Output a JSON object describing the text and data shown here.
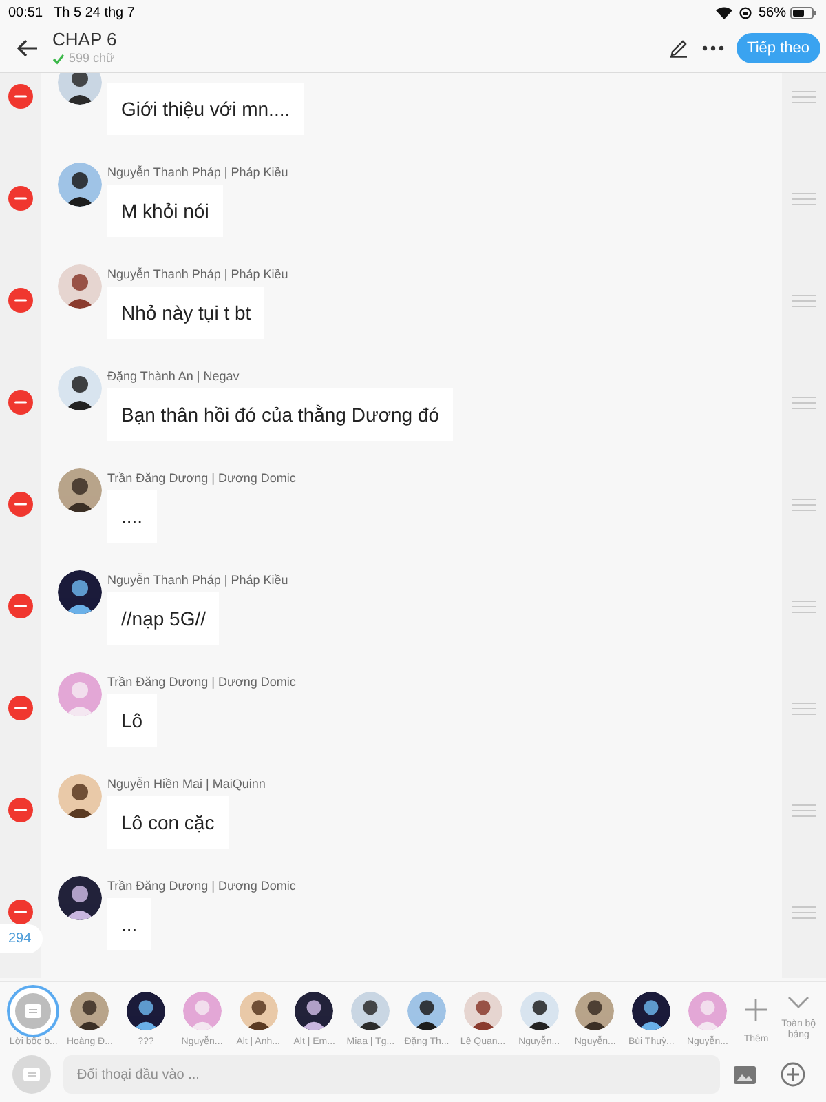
{
  "status_bar": {
    "time": "00:51",
    "date": "Th 5 24 thg 7",
    "battery": "56%"
  },
  "header": {
    "title": "CHAP 6",
    "word_count": "599 chữ",
    "next_button": "Tiếp theo"
  },
  "messages": [
    {
      "text": "Giới thiệu với mn...."
    },
    {
      "name": "Nguyễn Thanh Pháp | Pháp Kiều",
      "text": "M khỏi nói"
    },
    {
      "name": "Nguyễn Thanh Pháp | Pháp Kiều",
      "text": "Nhỏ này tụi t bt"
    },
    {
      "name": "Đặng Thành An | Negav",
      "text": "Bạn thân hồi đó của thằng Dương đó"
    },
    {
      "name": "Trần Đăng Dương | Dương Domic",
      "text": "...."
    },
    {
      "name": "Nguyễn Thanh Pháp | Pháp Kiều",
      "text": "//nạp 5G//"
    },
    {
      "name": "Trần Đăng Dương | Dương Domic",
      "text": "Lô"
    },
    {
      "name": "Nguyễn Hiền Mai | MaiQuinn",
      "text": "Lô con cặc"
    },
    {
      "name": "Trần Đăng Dương | Dương Domic",
      "text": "..."
    }
  ],
  "count_badge": "294",
  "cast": [
    {
      "kind": "narrator",
      "label": "Lời bốc b...",
      "selected": true
    },
    {
      "kind": "character",
      "label": "Hoàng Đ...",
      "selected": false
    },
    {
      "kind": "character",
      "label": "???",
      "selected": false
    },
    {
      "kind": "character",
      "label": "Nguyễn...",
      "selected": false
    },
    {
      "kind": "character",
      "label": "Alt | Anh...",
      "selected": false
    },
    {
      "kind": "character",
      "label": "Alt | Em...",
      "selected": false
    },
    {
      "kind": "character",
      "label": "Miaa | Tg...",
      "selected": false
    },
    {
      "kind": "character",
      "label": "Đặng Th...",
      "selected": false
    },
    {
      "kind": "character",
      "label": "Lê Quan...",
      "selected": false
    },
    {
      "kind": "character",
      "label": "Nguyễn...",
      "selected": false
    },
    {
      "kind": "character",
      "label": "Nguyễn...",
      "selected": false
    },
    {
      "kind": "character",
      "label": "Bùi Thuỳ...",
      "selected": false
    },
    {
      "kind": "character",
      "label": "Nguyễn...",
      "selected": false
    },
    {
      "kind": "add",
      "label": "Thêm"
    },
    {
      "kind": "expand",
      "label": "Toàn bộ bảng"
    }
  ],
  "composer": {
    "placeholder": "Đối thoại đầu vào ..."
  }
}
